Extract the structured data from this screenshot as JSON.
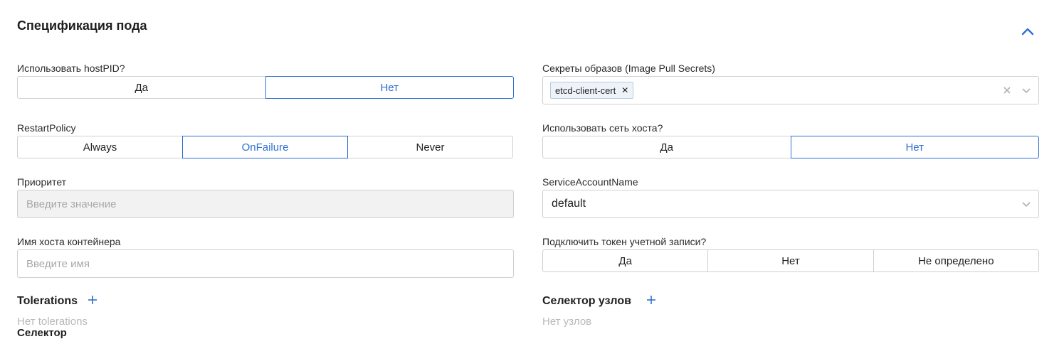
{
  "section": {
    "title": "Спецификация пода"
  },
  "host_pid": {
    "label": "Использовать hostPID?",
    "options": [
      "Да",
      "Нет"
    ],
    "selected": "Нет"
  },
  "restart_policy": {
    "label": "RestartPolicy",
    "options": [
      "Always",
      "OnFailure",
      "Never"
    ],
    "selected": "OnFailure"
  },
  "priority": {
    "label": "Приоритет",
    "placeholder": "Введите значение"
  },
  "hostname": {
    "label": "Имя хоста контейнера",
    "placeholder": "Введите имя"
  },
  "tolerations": {
    "title": "Tolerations",
    "empty": "Нет tolerations"
  },
  "image_pull_secrets": {
    "label": "Секреты образов (Image Pull Secrets)",
    "tags": [
      "etcd-client-cert"
    ]
  },
  "host_network": {
    "label": "Использовать сеть хоста?",
    "options": [
      "Да",
      "Нет"
    ],
    "selected": "Нет"
  },
  "service_account": {
    "label": "ServiceAccountName",
    "value": "default"
  },
  "automount_token": {
    "label": "Подключить токен учетной записи?",
    "options": [
      "Да",
      "Нет",
      "Не определено"
    ],
    "selected": ""
  },
  "node_selector": {
    "title": "Селектор узлов",
    "empty": "Нет узлов"
  },
  "cut_off_heading": "Селектор",
  "colors": {
    "accent": "#2f6fd1",
    "border": "#d0d0d0",
    "placeholder": "#a8a8a8",
    "disabled_bg": "#f2f2f2"
  },
  "icons": [
    "chevron-up-icon",
    "clear-icon",
    "chevron-down-icon",
    "plus-icon",
    "tag-remove-icon"
  ]
}
